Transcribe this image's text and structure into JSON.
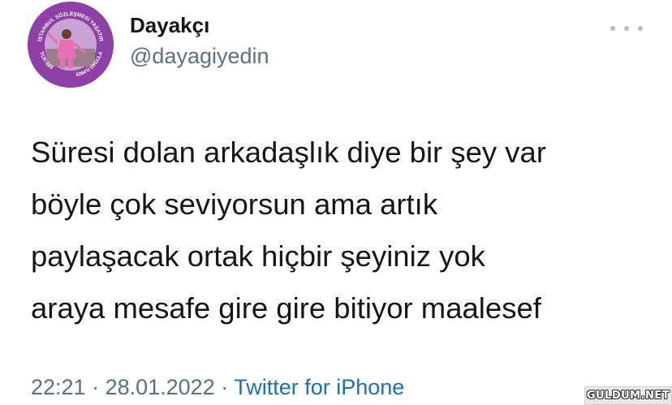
{
  "author": {
    "display_name": "Dayakçı",
    "handle": "@dayagiyedin",
    "avatar": {
      "arc_text_top": "İSTANBUL SÖZLEŞMESİ YAŞATIR",
      "arc_text_left": "TCK-103",
      "arc_text_right": "6284'Ü UYGULA",
      "ring_color": "#8e3fa8",
      "background_color": "#c9a3d6",
      "figure_color": "#e86fb2"
    }
  },
  "more_icon": "ellipsis-icon",
  "tweet": {
    "lines": [
      "Süresi dolan arkadaşlık diye bir şey var",
      "böyle çok seviyorsun ama artık",
      "paylaşacak ortak hiçbir şeyiniz yok",
      "araya mesafe gire gire bitiyor maalesef"
    ]
  },
  "meta": {
    "time": "22:21",
    "separator": " · ",
    "date": "28.01.2022",
    "source": "Twitter for iPhone"
  },
  "watermark": "GULDUM.NET",
  "colors": {
    "text_primary": "#14171a",
    "text_secondary": "#5b7083",
    "link": "#1d6fb8"
  }
}
